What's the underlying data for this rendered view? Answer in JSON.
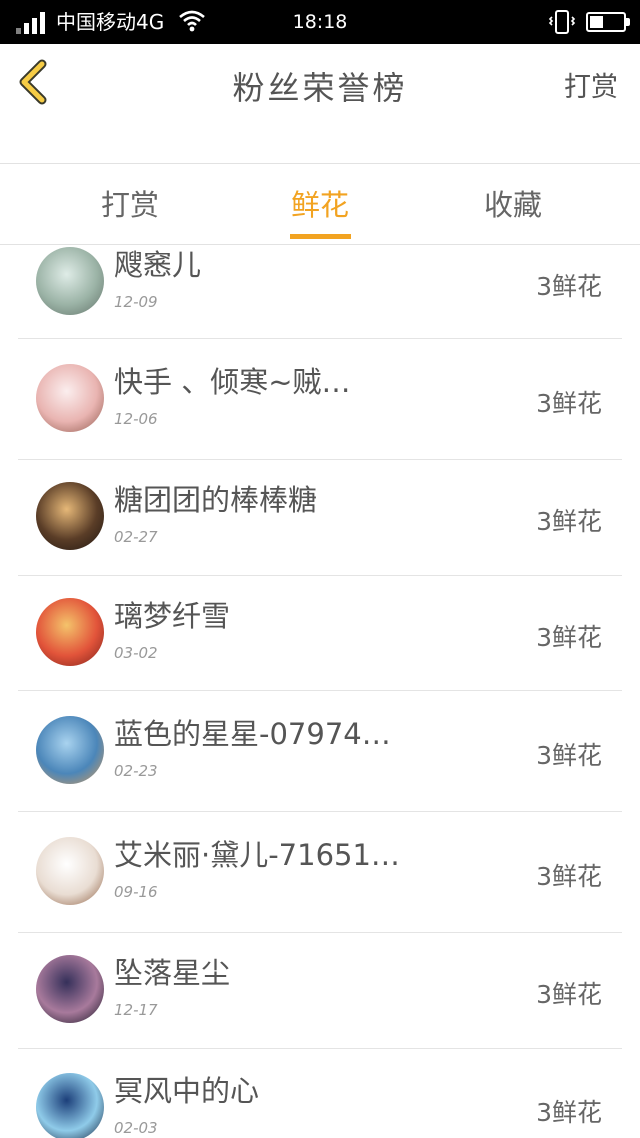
{
  "status_bar": {
    "carrier": "中国移动4G",
    "time": "18:18",
    "battery_level": 0.4
  },
  "header": {
    "title": "粉丝荣誉榜",
    "action_label": "打赏"
  },
  "tabs": [
    {
      "label": "打赏",
      "active": false
    },
    {
      "label": "鲜花",
      "active": true
    },
    {
      "label": "收藏",
      "active": false
    }
  ],
  "colors": {
    "accent": "#f2a321"
  },
  "fans": [
    {
      "name": "飕窸儿",
      "date": "12-09",
      "amount": "3鲜花",
      "avatar_colors": [
        "#dfece7",
        "#9bb3a6",
        "#5f6f66"
      ]
    },
    {
      "name": "快手 、倾寒~贼…",
      "date": "12-06",
      "amount": "3鲜花",
      "avatar_colors": [
        "#fbeeee",
        "#e9b4b1",
        "#8c5548"
      ]
    },
    {
      "name": "糖团团的棒棒糖",
      "date": "02-27",
      "amount": "3鲜花",
      "avatar_colors": [
        "#e6b878",
        "#5a3d27",
        "#1d1410"
      ]
    },
    {
      "name": "璃梦纤雪",
      "date": "03-02",
      "amount": "3鲜花",
      "avatar_colors": [
        "#f4c36b",
        "#e2543a",
        "#7a1f1a"
      ]
    },
    {
      "name": "蓝色的星星-07974…",
      "date": "02-23",
      "amount": "3鲜花",
      "avatar_colors": [
        "#a9d3ef",
        "#4b86b9",
        "#d99b57"
      ]
    },
    {
      "name": "艾米丽·黛儿-71651…",
      "date": "09-16",
      "amount": "3鲜花",
      "avatar_colors": [
        "#ffffff",
        "#e9ddd3",
        "#8a5a3c"
      ]
    },
    {
      "name": "坠落星尘",
      "date": "12-17",
      "amount": "3鲜花",
      "avatar_colors": [
        "#35305a",
        "#a87a9c",
        "#11101f"
      ]
    },
    {
      "name": "冥风中的心",
      "date": "02-03",
      "amount": "3鲜花",
      "avatar_colors": [
        "#1c3f7a",
        "#8fcbe9",
        "#0a1630"
      ]
    }
  ]
}
